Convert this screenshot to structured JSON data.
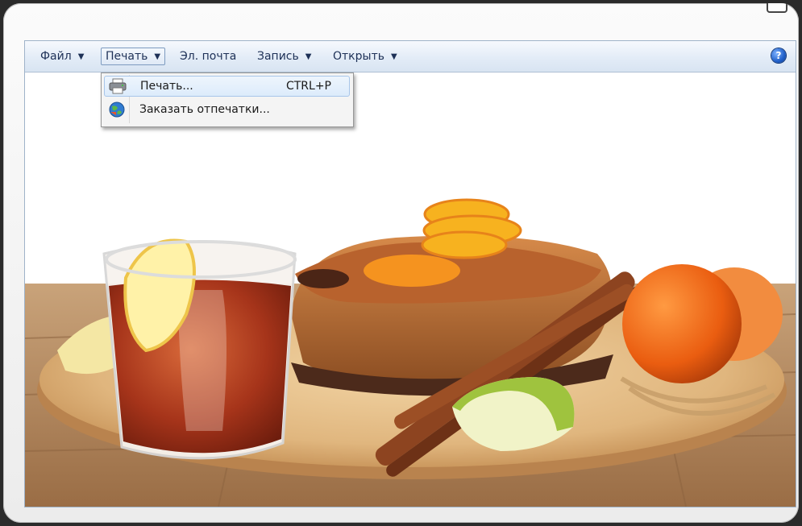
{
  "menubar": {
    "items": [
      {
        "label": "Файл",
        "has_arrow": true
      },
      {
        "label": "Печать",
        "has_arrow": true,
        "active": true
      },
      {
        "label": "Эл. почта",
        "has_arrow": false
      },
      {
        "label": "Запись",
        "has_arrow": true
      },
      {
        "label": "Открыть",
        "has_arrow": true
      }
    ],
    "arrow_glyph": "▼",
    "help_glyph": "?"
  },
  "dropdown": {
    "items": [
      {
        "label": "Печать...",
        "shortcut": "CTRL+P",
        "icon": "printer-icon"
      },
      {
        "label": "Заказать отпечатки...",
        "shortcut": "",
        "icon": "globe-icon"
      }
    ]
  },
  "colors": {
    "menu_text": "#1e3157",
    "menubar_bg": "#e3ecf7",
    "highlight": "#dcebfb"
  }
}
